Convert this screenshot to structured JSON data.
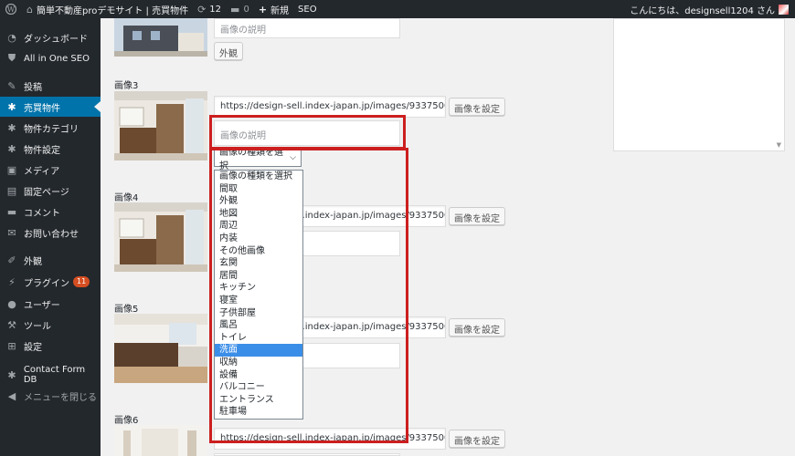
{
  "adminbar": {
    "site_name": "簡単不動産proデモサイト | 売買物件",
    "updates": "12",
    "comments": "0",
    "new_label": "新規",
    "seo_label": "SEO",
    "greeting": "こんにちは、designsell1204 さん"
  },
  "sidebar": {
    "items": [
      {
        "label": "ダッシュボード",
        "icon": "dashboard-icon"
      },
      {
        "label": "All in One SEO",
        "icon": "shield-icon"
      },
      {
        "label": "投稿",
        "icon": "pin-icon"
      },
      {
        "label": "売買物件",
        "icon": "gear-icon",
        "current": true
      },
      {
        "label": "物件カテゴリ",
        "icon": "gear-icon"
      },
      {
        "label": "物件設定",
        "icon": "gear-icon"
      },
      {
        "label": "メディア",
        "icon": "media-icon"
      },
      {
        "label": "固定ページ",
        "icon": "page-icon"
      },
      {
        "label": "コメント",
        "icon": "comment-icon"
      },
      {
        "label": "お問い合わせ",
        "icon": "mail-icon"
      },
      {
        "label": "外観",
        "icon": "brush-icon"
      },
      {
        "label": "プラグイン",
        "icon": "plugin-icon",
        "badge": "11"
      },
      {
        "label": "ユーザー",
        "icon": "user-icon"
      },
      {
        "label": "ツール",
        "icon": "wrench-icon"
      },
      {
        "label": "設定",
        "icon": "settings-icon"
      },
      {
        "label": "Contact Form DB",
        "icon": "gear-icon"
      },
      {
        "label": "メニューを閉じる",
        "icon": "collapse-icon",
        "muted": true
      }
    ]
  },
  "images": {
    "top": {
      "desc_placeholder": "画像の説明",
      "type_button": "外観"
    },
    "image3": {
      "label": "画像3",
      "url": "https://design-sell.index-japan.jp/images/93375000_0041.",
      "set_button": "画像を設定",
      "desc_placeholder": "画像の説明",
      "select_value": "画像の種類を選択"
    },
    "image4": {
      "label": "画像4",
      "url": "https://design-sell.index-japan.jp/images/93375000_0041.",
      "set_button": "画像を設定"
    },
    "image5": {
      "label": "画像5",
      "url": "https://design-sell.index-japan.jp/images/93375000_0002.",
      "set_button": "画像を設定"
    },
    "image6": {
      "label": "画像6",
      "url": "https://design-sell.index-japan.jp/images/93375000_0040.",
      "set_button": "画像を設定"
    }
  },
  "dropdown": {
    "options": [
      "画像の種類を選択",
      "間取",
      "外観",
      "地図",
      "周辺",
      "内装",
      "その他画像",
      "玄関",
      "居間",
      "キッチン",
      "寝室",
      "子供部屋",
      "風呂",
      "トイレ",
      "洗面",
      "収納",
      "設備",
      "バルコニー",
      "エントランス",
      "駐車場"
    ],
    "highlighted": "洗面"
  },
  "colors": {
    "accent": "#0073aa",
    "highlight_box": "#cc1f1f",
    "adminbar": "#23282d"
  }
}
